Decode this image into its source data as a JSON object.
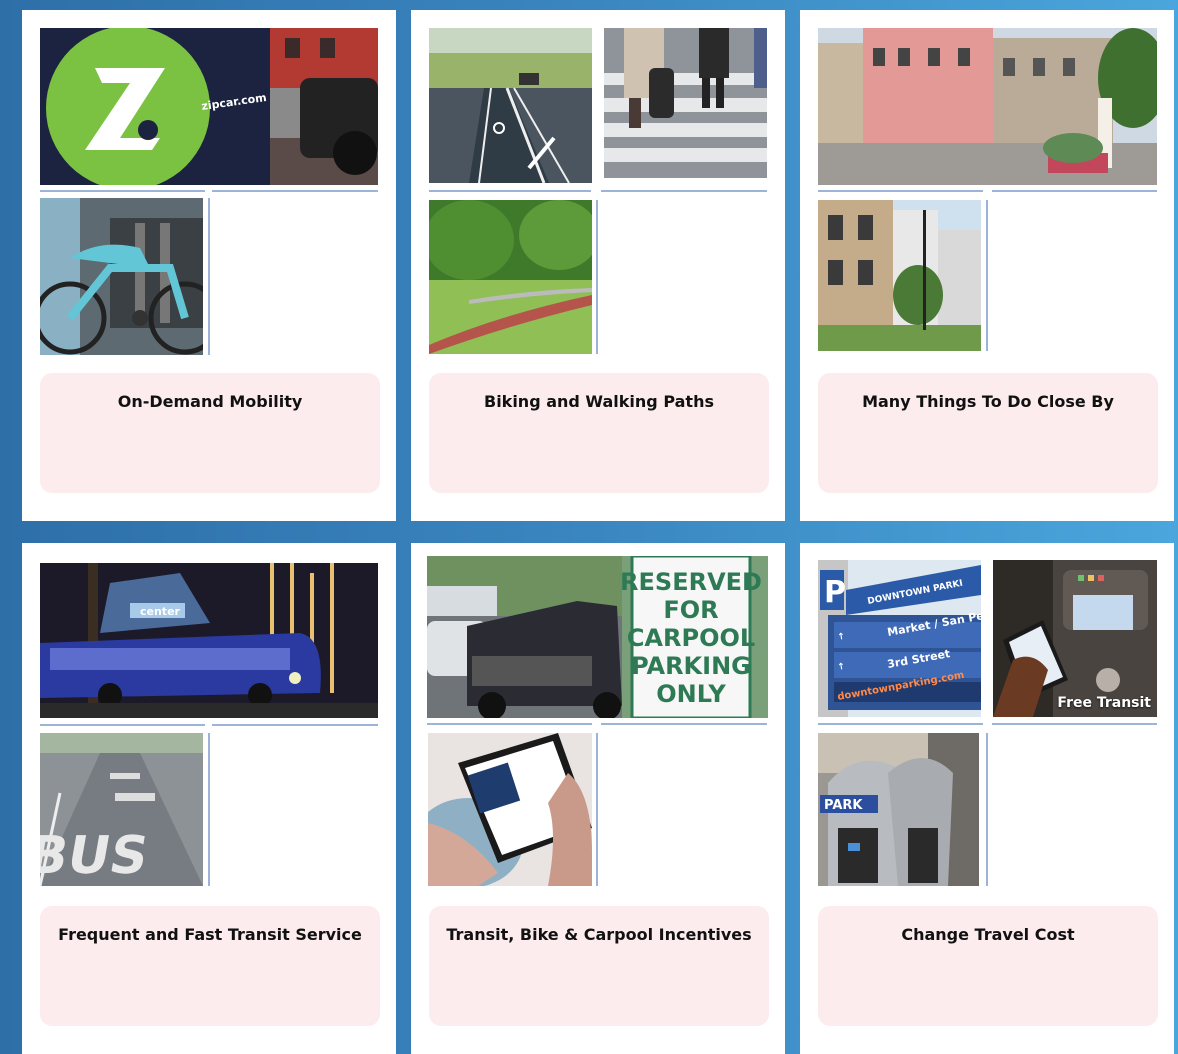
{
  "cards": [
    {
      "label": "On-Demand Mobility",
      "photos": [
        "zipcar-car-photo",
        "bikeshare-bike-photo"
      ],
      "photo_text": {
        "zipcar_brand": "zipcar.com"
      }
    },
    {
      "label": "Biking and Walking Paths",
      "photos": [
        "bike-lane-photo",
        "crosswalk-photo",
        "park-path-photo"
      ]
    },
    {
      "label": "Many Things To Do Close By",
      "photos": [
        "downtown-street-photo",
        "mixed-use-building-photo"
      ]
    },
    {
      "label": "Frequent and Fast Transit Service",
      "photos": [
        "bus-at-night-photo",
        "bus-lane-marking-photo"
      ],
      "photo_text": {
        "center_sign": "center",
        "lane_text": "BUS"
      }
    },
    {
      "label": "Transit, Bike & Carpool Incentives",
      "photos": [
        "carpool-parking-photo",
        "transit-card-phone-photo"
      ],
      "photo_text": {
        "sign_lines": [
          "RESERVED",
          "FOR",
          "CARPOOL",
          "PARKING",
          "ONLY"
        ]
      }
    },
    {
      "label": "Change Travel Cost",
      "photos": [
        "parking-sign-photo",
        "free-transit-photo",
        "parking-meter-photo"
      ],
      "photo_text": {
        "parking_header": "DOWNTOWN PARKI",
        "parking_row1": "Market / San Ped",
        "parking_row2": "3rd Street",
        "parking_url": "downtownparking.com",
        "free_transit": "Free Transit",
        "meter_brand": "PARK"
      }
    }
  ],
  "colors": {
    "background_left": "#2e6fa8",
    "background_right": "#4aa6dc",
    "label_box": "#fcecee",
    "divider": "#9bb4d8"
  }
}
